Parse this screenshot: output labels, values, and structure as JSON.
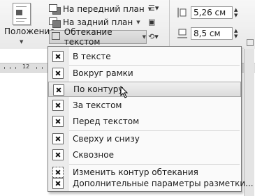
{
  "ribbon": {
    "position_label": "Положение",
    "bring_forward_label": "На передний план",
    "send_backward_label": "На задний план",
    "wrap_text_label": "Обтекание текстом",
    "height_value": "5,26 см",
    "width_value": "8,5 см"
  },
  "ruler": {
    "number": "12"
  },
  "wrap_menu": {
    "items": [
      {
        "label": "В тексте"
      },
      {
        "label": "Вокруг рамки"
      },
      {
        "label": "По контуру"
      },
      {
        "label": "За текстом"
      },
      {
        "label": "Перед текстом"
      },
      {
        "label": "Сверху и снизу"
      },
      {
        "label": "Сквозное"
      },
      {
        "label": "Изменить контур обтекания"
      },
      {
        "label": "Дополнительные параметры разметки..."
      }
    ],
    "highlighted_item": "По контуру"
  }
}
